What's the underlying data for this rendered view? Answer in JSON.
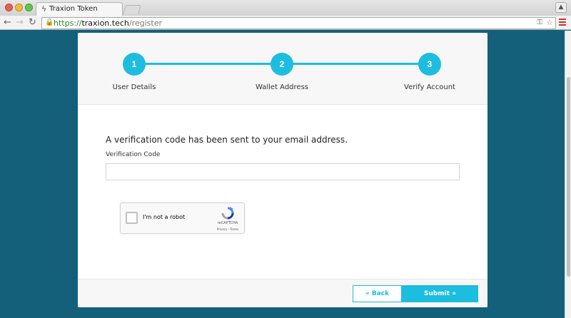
{
  "browser": {
    "tab_title": "Traxion Token",
    "url_protocol": "https://",
    "url_host": "traxion.tech",
    "url_path": "/register",
    "accent_menu_color": "#d0312d"
  },
  "steps": [
    {
      "number": "1",
      "label": "User Details"
    },
    {
      "number": "2",
      "label": "Wallet Address"
    },
    {
      "number": "3",
      "label": "Verify Account"
    }
  ],
  "form": {
    "message": "A verification code has been sent to your email address.",
    "code_label": "Verification Code",
    "code_value": "",
    "code_placeholder": ""
  },
  "captcha": {
    "label": "I'm not a robot",
    "brand": "reCAPTCHA",
    "links": "Privacy - Terms"
  },
  "actions": {
    "back_label": "« Back",
    "submit_label": "Submit »"
  },
  "theme": {
    "accent": "#1dbde0",
    "background": "#14607a"
  }
}
